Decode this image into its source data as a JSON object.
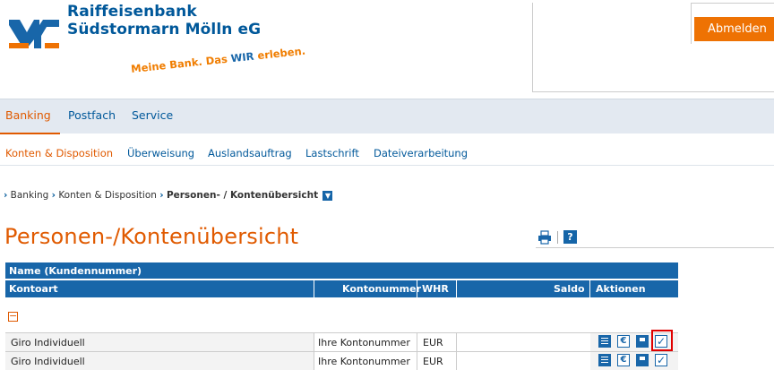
{
  "bank": {
    "name_line1": "Raiffeisenbank",
    "name_line2": "Südstormarn Mölln eG",
    "slogan_a": "Meine Bank. Das ",
    "slogan_b": "WIR",
    "slogan_c": " erleben."
  },
  "header": {
    "logout_label": "Abmelden"
  },
  "mainnav": {
    "items": [
      "Banking",
      "Postfach",
      "Service"
    ],
    "active": "Banking"
  },
  "subnav": {
    "items": [
      "Konten & Disposition",
      "Überweisung",
      "Auslandsauftrag",
      "Lastschrift",
      "Dateiverarbeitung"
    ]
  },
  "breadcrumb": {
    "items": [
      "Banking",
      "Konten & Disposition",
      "Personen- / Kontenübersicht"
    ]
  },
  "page": {
    "title": "Personen-/Kontenübersicht"
  },
  "table": {
    "header1": "Name (Kundennummer)",
    "columns": [
      "Kontoart",
      "Kontonummer",
      "WHR",
      "Saldo",
      "Aktionen"
    ],
    "rows": [
      {
        "kontoart": "Giro Individuell",
        "kontonummer": "Ihre Kontonummer",
        "whr": "EUR",
        "saldo": ""
      },
      {
        "kontoart": "Giro Individuell",
        "kontonummer": "Ihre Kontonummer",
        "whr": "EUR",
        "saldo": ""
      }
    ]
  },
  "colors": {
    "brand_blue": "#1866a9",
    "brand_orange": "#ee7203",
    "highlight": "#e00000"
  }
}
